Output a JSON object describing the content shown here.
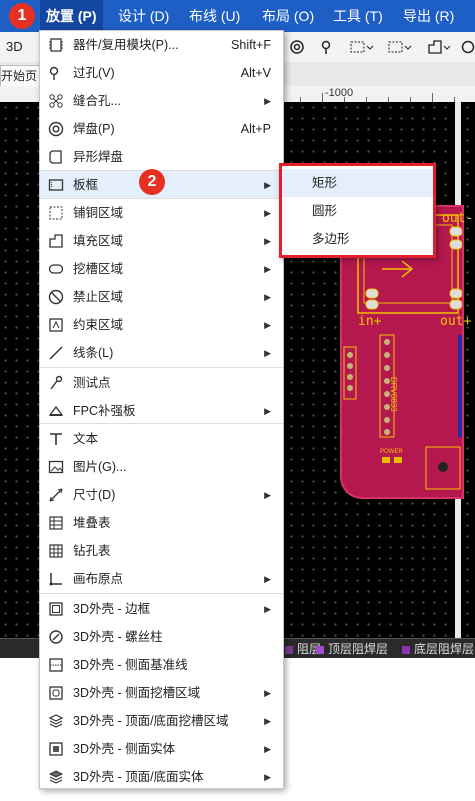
{
  "menubar": {
    "items": [
      {
        "label": "放置 (P)"
      },
      {
        "label": "设计 (D)"
      },
      {
        "label": "布线 (U)"
      },
      {
        "label": "布局 (O)"
      },
      {
        "label": "工具 (T)"
      },
      {
        "label": "导出 (R)"
      }
    ]
  },
  "badges": [
    "1",
    "2"
  ],
  "toolbar": {
    "label_3d": "3D"
  },
  "tab": {
    "label": "开始页"
  },
  "ruler": {
    "label": "-1000"
  },
  "layers": [
    {
      "label": "阻层",
      "color": "#7a3a8a"
    },
    {
      "label": "顶层阻焊层",
      "color": "#a24fcf"
    },
    {
      "label": "底层阻焊层",
      "color": "#8f30b8"
    }
  ],
  "place_menu": {
    "items": [
      {
        "label": "器件/复用模块(P)...",
        "shortcut": "Shift+F",
        "icon": "component-icon"
      },
      {
        "label": "过孔(V)",
        "shortcut": "Alt+V",
        "icon": "via-icon"
      },
      {
        "label": "缝合孔...",
        "shortcut": "",
        "icon": "stitching-via-icon",
        "submenu": true
      },
      {
        "label": "焊盘(P)",
        "shortcut": "Alt+P",
        "icon": "pad-icon"
      },
      {
        "label": "异形焊盘",
        "shortcut": "",
        "icon": "custom-pad-icon"
      },
      {
        "label": "板框",
        "shortcut": "",
        "icon": "board-outline-icon",
        "submenu": true
      },
      {
        "label": "铺铜区域",
        "shortcut": "",
        "icon": "copper-pour-icon",
        "submenu": true
      },
      {
        "label": "填充区域",
        "shortcut": "",
        "icon": "fill-region-icon",
        "submenu": true
      },
      {
        "label": "挖槽区域",
        "shortcut": "",
        "icon": "slot-region-icon",
        "submenu": true
      },
      {
        "label": "禁止区域",
        "shortcut": "",
        "icon": "keepout-region-icon",
        "submenu": true
      },
      {
        "label": "约束区域",
        "shortcut": "",
        "icon": "constraint-region-icon",
        "submenu": true
      },
      {
        "label": "线条(L)",
        "shortcut": "",
        "icon": "line-icon",
        "submenu": true
      },
      {
        "label": "测试点",
        "shortcut": "",
        "icon": "test-point-icon"
      },
      {
        "label": "FPC补强板",
        "shortcut": "",
        "icon": "fpc-stiffener-icon",
        "submenu": true
      },
      {
        "label": "文本",
        "shortcut": "",
        "icon": "text-icon"
      },
      {
        "label": "图片(G)...",
        "shortcut": "",
        "icon": "image-icon"
      },
      {
        "label": "尺寸(D)",
        "shortcut": "",
        "icon": "dimension-icon",
        "submenu": true
      },
      {
        "label": "堆叠表",
        "shortcut": "",
        "icon": "stackup-table-icon"
      },
      {
        "label": "钻孔表",
        "shortcut": "",
        "icon": "drill-table-icon"
      },
      {
        "label": "画布原点",
        "shortcut": "",
        "icon": "canvas-origin-icon",
        "submenu": true
      },
      {
        "label": "3D外壳 - 边框",
        "shortcut": "",
        "icon": "shell-border-icon",
        "submenu": true
      },
      {
        "label": "3D外壳 - 螺丝柱",
        "shortcut": "",
        "icon": "shell-screw-icon"
      },
      {
        "label": "3D外壳 - 侧面基准线",
        "shortcut": "",
        "icon": "shell-side-line-icon"
      },
      {
        "label": "3D外壳 - 侧面挖槽区域",
        "shortcut": "",
        "icon": "shell-side-slot-icon",
        "submenu": true
      },
      {
        "label": "3D外壳 - 顶面/底面挖槽区域",
        "shortcut": "",
        "icon": "shell-top-slot-icon",
        "submenu": true
      },
      {
        "label": "3D外壳 - 侧面实体",
        "shortcut": "",
        "icon": "shell-side-solid-icon",
        "submenu": true
      },
      {
        "label": "3D外壳 - 顶面/底面实体",
        "shortcut": "",
        "icon": "shell-top-solid-icon",
        "submenu": true
      }
    ]
  },
  "board_submenu": {
    "items": [
      {
        "label": "矩形"
      },
      {
        "label": "圆形"
      },
      {
        "label": "多边形"
      }
    ]
  },
  "pcb": {
    "texts": [
      "out-",
      "in+",
      "out+",
      "DRV8833",
      "POWER"
    ]
  }
}
